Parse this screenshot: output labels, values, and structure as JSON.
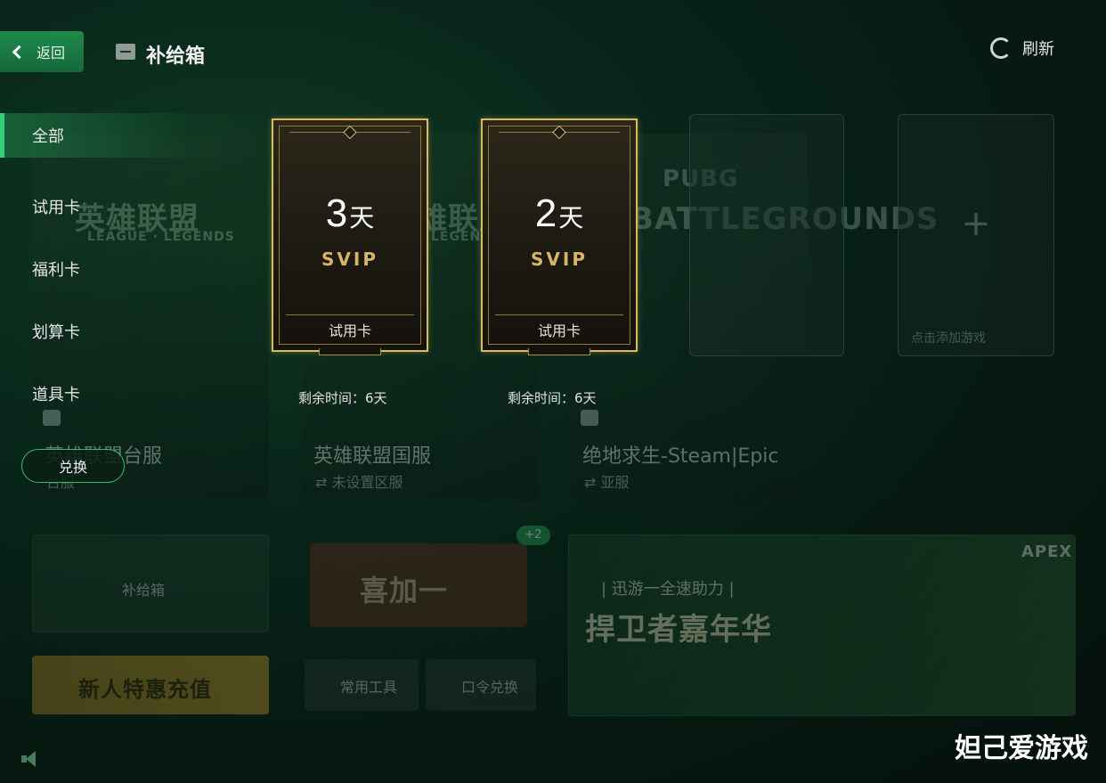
{
  "topbar": {
    "back_label": "返回",
    "title": "补给箱",
    "refresh_label": "刷新"
  },
  "sidebar": {
    "items": [
      {
        "label": "全部",
        "active": true
      },
      {
        "label": "试用卡",
        "active": false
      },
      {
        "label": "福利卡",
        "active": false
      },
      {
        "label": "划算卡",
        "active": false
      },
      {
        "label": "道具卡",
        "active": false
      }
    ],
    "redeem_label": "兑换"
  },
  "cards": [
    {
      "days": "3",
      "unit": "天",
      "tier": "SVIP",
      "type_label": "试用卡",
      "remaining": "剩余时间：6天"
    },
    {
      "days": "2",
      "unit": "天",
      "tier": "SVIP",
      "type_label": "试用卡",
      "remaining": "剩余时间：6天"
    }
  ],
  "background": {
    "games": [
      {
        "logo": "英雄联盟",
        "logo_sub": "LEAGUE · LEGENDS",
        "title": "英雄联盟台服",
        "subtitle": "台服"
      },
      {
        "logo": "雄联盟",
        "logo_sub": "LEGENDS",
        "title": "英雄联盟国服",
        "subtitle": "⇄  未设置区服"
      },
      {
        "logo": "PUBG",
        "logo_sub": "BATTLEGROUNDS",
        "title": "绝地求生-Steam|Epic",
        "subtitle": "⇄  亚服"
      }
    ],
    "add_game_label": "点击添加游戏",
    "supply_box_label": "补给箱",
    "plus_one_label": "喜加一",
    "plus_badge": "+2",
    "tools_label": "常用工具",
    "code_label": "口令兑换",
    "newbie_label": "新人特惠充值",
    "banner_tagline": "| 迅游一全速助力 |",
    "banner_title": "捍卫者嘉年华",
    "banner_logo": "APEX"
  },
  "watermark": "妲己爱游戏",
  "colors": {
    "accent_green": "#2fd276",
    "gold_border": "#d9bb5e",
    "gold_text": "#d6b565"
  }
}
